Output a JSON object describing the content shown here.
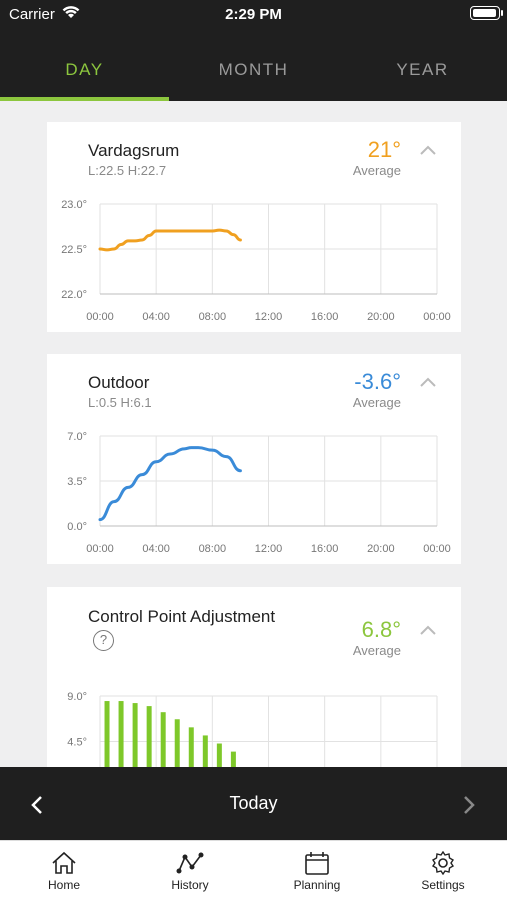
{
  "status_bar": {
    "carrier": "Carrier",
    "time": "2:29 PM"
  },
  "tabs": [
    {
      "label": "DAY",
      "active": true
    },
    {
      "label": "MONTH",
      "active": false
    },
    {
      "label": "YEAR",
      "active": false
    }
  ],
  "cards": [
    {
      "title": "Vardagsrum",
      "subtitle": "L:22.5 H:22.7",
      "value": "21°",
      "value_color": "#f0a020",
      "avg_label": "Average"
    },
    {
      "title": "Outdoor",
      "subtitle": "L:0.5 H:6.1",
      "value": "-3.6°",
      "value_color": "#3a8bd8",
      "avg_label": "Average"
    },
    {
      "title": "Control Point Adjustment",
      "help": "?",
      "value": "6.8°",
      "value_color": "#8cc63e",
      "avg_label": "Average"
    }
  ],
  "chart_data": [
    {
      "type": "line",
      "color": "#f0a020",
      "y_ticks": [
        "23.0°",
        "22.5°",
        "22.0°"
      ],
      "ylim": [
        22.0,
        23.0
      ],
      "x_ticks": [
        "00:00",
        "04:00",
        "08:00",
        "12:00",
        "16:00",
        "20:00",
        "00:00"
      ],
      "xlim": [
        0,
        24
      ],
      "series": [
        {
          "x": [
            0,
            0.5,
            1,
            1.5,
            2,
            2.5,
            3,
            3.5,
            4,
            5,
            6,
            7,
            8,
            8.5,
            9,
            9.5,
            10
          ],
          "y": [
            22.5,
            22.49,
            22.5,
            22.55,
            22.59,
            22.59,
            22.6,
            22.65,
            22.7,
            22.7,
            22.7,
            22.7,
            22.7,
            22.71,
            22.7,
            22.66,
            22.6
          ]
        }
      ]
    },
    {
      "type": "line",
      "color": "#3a8bd8",
      "y_ticks": [
        "7.0°",
        "3.5°",
        "0.0°"
      ],
      "ylim": [
        0,
        7
      ],
      "x_ticks": [
        "00:00",
        "04:00",
        "08:00",
        "12:00",
        "16:00",
        "20:00",
        "00:00"
      ],
      "xlim": [
        0,
        24
      ],
      "series": [
        {
          "x": [
            0,
            1,
            2,
            3,
            4,
            5,
            6,
            6.5,
            7,
            8,
            9,
            10
          ],
          "y": [
            0.5,
            1.9,
            3.0,
            4.0,
            5.0,
            5.6,
            6.0,
            6.1,
            6.1,
            5.9,
            5.4,
            4.3
          ]
        }
      ]
    },
    {
      "type": "bar",
      "color": "#7ec82a",
      "y_ticks": [
        "9.0°",
        "4.5°"
      ],
      "ylim": [
        0,
        9
      ],
      "xlim": [
        0,
        24
      ],
      "x": [
        0.5,
        1.5,
        2.5,
        3.5,
        4.5,
        5.5,
        6.5,
        7.5,
        8.5,
        9.5
      ],
      "values": [
        8.5,
        8.5,
        8.3,
        8.0,
        7.4,
        6.7,
        5.9,
        5.1,
        4.3,
        3.5
      ]
    }
  ],
  "date_nav": {
    "label": "Today"
  },
  "tabbar": [
    {
      "label": "Home"
    },
    {
      "label": "History",
      "active": true
    },
    {
      "label": "Planning"
    },
    {
      "label": "Settings"
    }
  ]
}
